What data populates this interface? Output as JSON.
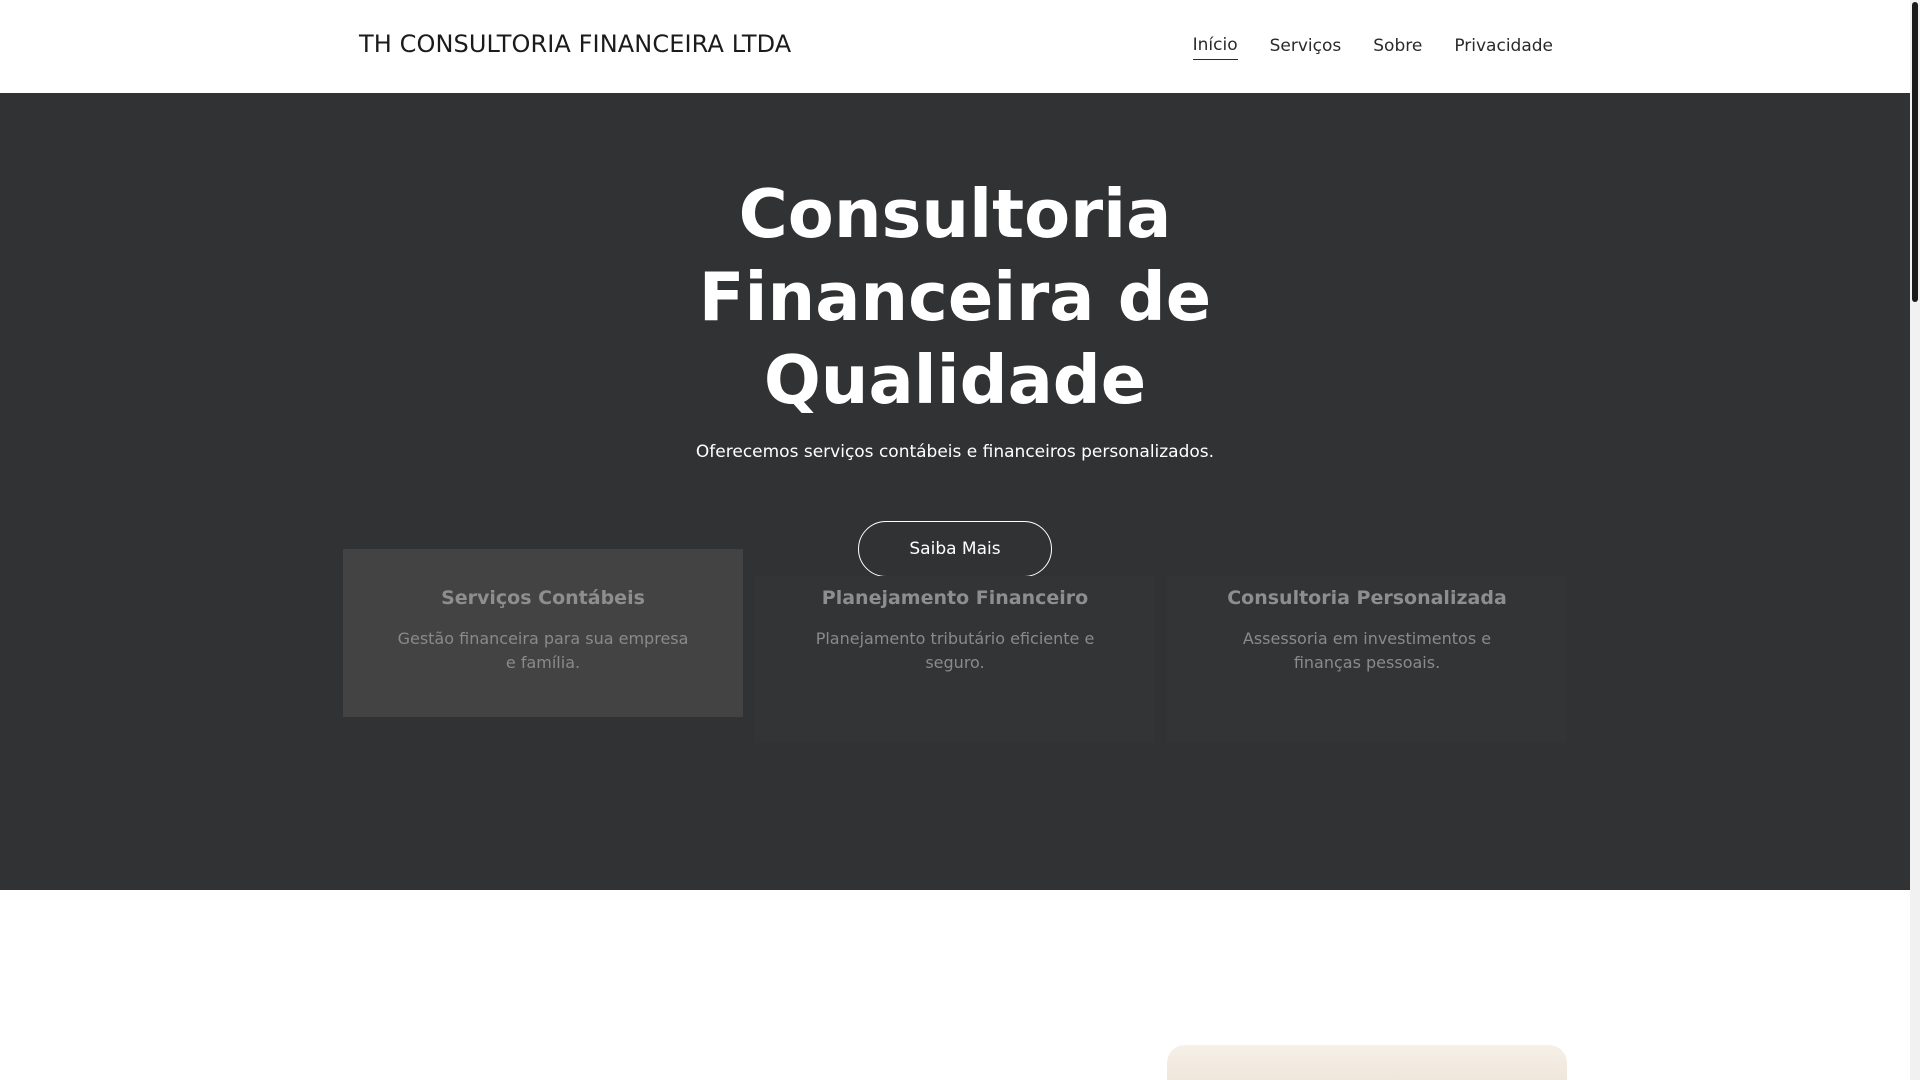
{
  "header": {
    "brand": "TH CONSULTORIA FINANCEIRA LTDA",
    "nav": [
      {
        "label": "Início",
        "active": true
      },
      {
        "label": "Serviços"
      },
      {
        "label": "Sobre"
      },
      {
        "label": "Privacidade"
      }
    ]
  },
  "hero": {
    "title_lines": [
      "Consultoria",
      "Financeira de",
      "Qualidade"
    ],
    "subtitle": "Oferecemos serviços contábeis e financeiros personalizados.",
    "button_label": "Saiba Mais",
    "background_color": "#313233"
  },
  "services": [
    {
      "title": "Serviços Contábeis",
      "text": "Gestão financeira para sua empresa e família."
    },
    {
      "title": "Planejamento Financeiro",
      "text": "Planejamento tributário eficiente e seguro."
    },
    {
      "title": "Consultoria Personalizada",
      "text": "Assessoria em investimentos e finanças pessoais."
    }
  ]
}
